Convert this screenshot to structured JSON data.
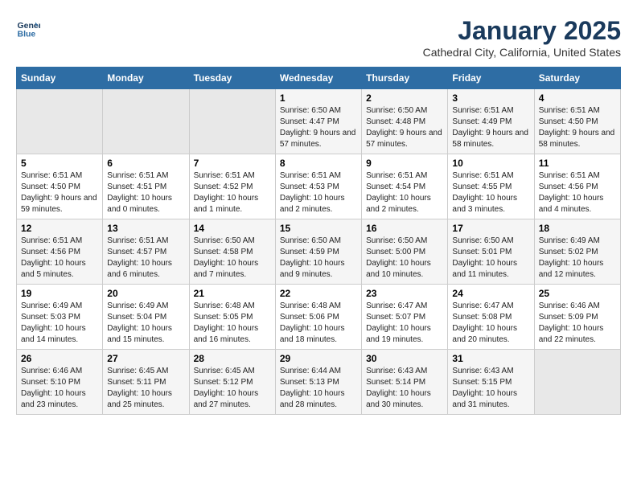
{
  "header": {
    "logo_line1": "General",
    "logo_line2": "Blue",
    "month": "January 2025",
    "location": "Cathedral City, California, United States"
  },
  "weekdays": [
    "Sunday",
    "Monday",
    "Tuesday",
    "Wednesday",
    "Thursday",
    "Friday",
    "Saturday"
  ],
  "weeks": [
    [
      {
        "day": "",
        "empty": true
      },
      {
        "day": "",
        "empty": true
      },
      {
        "day": "",
        "empty": true
      },
      {
        "day": "1",
        "sunrise": "6:50 AM",
        "sunset": "4:47 PM",
        "daylight": "9 hours and 57 minutes."
      },
      {
        "day": "2",
        "sunrise": "6:50 AM",
        "sunset": "4:48 PM",
        "daylight": "9 hours and 57 minutes."
      },
      {
        "day": "3",
        "sunrise": "6:51 AM",
        "sunset": "4:49 PM",
        "daylight": "9 hours and 58 minutes."
      },
      {
        "day": "4",
        "sunrise": "6:51 AM",
        "sunset": "4:50 PM",
        "daylight": "9 hours and 58 minutes."
      }
    ],
    [
      {
        "day": "5",
        "sunrise": "6:51 AM",
        "sunset": "4:50 PM",
        "daylight": "9 hours and 59 minutes."
      },
      {
        "day": "6",
        "sunrise": "6:51 AM",
        "sunset": "4:51 PM",
        "daylight": "10 hours and 0 minutes."
      },
      {
        "day": "7",
        "sunrise": "6:51 AM",
        "sunset": "4:52 PM",
        "daylight": "10 hours and 1 minute."
      },
      {
        "day": "8",
        "sunrise": "6:51 AM",
        "sunset": "4:53 PM",
        "daylight": "10 hours and 2 minutes."
      },
      {
        "day": "9",
        "sunrise": "6:51 AM",
        "sunset": "4:54 PM",
        "daylight": "10 hours and 2 minutes."
      },
      {
        "day": "10",
        "sunrise": "6:51 AM",
        "sunset": "4:55 PM",
        "daylight": "10 hours and 3 minutes."
      },
      {
        "day": "11",
        "sunrise": "6:51 AM",
        "sunset": "4:56 PM",
        "daylight": "10 hours and 4 minutes."
      }
    ],
    [
      {
        "day": "12",
        "sunrise": "6:51 AM",
        "sunset": "4:56 PM",
        "daylight": "10 hours and 5 minutes."
      },
      {
        "day": "13",
        "sunrise": "6:51 AM",
        "sunset": "4:57 PM",
        "daylight": "10 hours and 6 minutes."
      },
      {
        "day": "14",
        "sunrise": "6:50 AM",
        "sunset": "4:58 PM",
        "daylight": "10 hours and 7 minutes."
      },
      {
        "day": "15",
        "sunrise": "6:50 AM",
        "sunset": "4:59 PM",
        "daylight": "10 hours and 9 minutes."
      },
      {
        "day": "16",
        "sunrise": "6:50 AM",
        "sunset": "5:00 PM",
        "daylight": "10 hours and 10 minutes."
      },
      {
        "day": "17",
        "sunrise": "6:50 AM",
        "sunset": "5:01 PM",
        "daylight": "10 hours and 11 minutes."
      },
      {
        "day": "18",
        "sunrise": "6:49 AM",
        "sunset": "5:02 PM",
        "daylight": "10 hours and 12 minutes."
      }
    ],
    [
      {
        "day": "19",
        "sunrise": "6:49 AM",
        "sunset": "5:03 PM",
        "daylight": "10 hours and 14 minutes."
      },
      {
        "day": "20",
        "sunrise": "6:49 AM",
        "sunset": "5:04 PM",
        "daylight": "10 hours and 15 minutes."
      },
      {
        "day": "21",
        "sunrise": "6:48 AM",
        "sunset": "5:05 PM",
        "daylight": "10 hours and 16 minutes."
      },
      {
        "day": "22",
        "sunrise": "6:48 AM",
        "sunset": "5:06 PM",
        "daylight": "10 hours and 18 minutes."
      },
      {
        "day": "23",
        "sunrise": "6:47 AM",
        "sunset": "5:07 PM",
        "daylight": "10 hours and 19 minutes."
      },
      {
        "day": "24",
        "sunrise": "6:47 AM",
        "sunset": "5:08 PM",
        "daylight": "10 hours and 20 minutes."
      },
      {
        "day": "25",
        "sunrise": "6:46 AM",
        "sunset": "5:09 PM",
        "daylight": "10 hours and 22 minutes."
      }
    ],
    [
      {
        "day": "26",
        "sunrise": "6:46 AM",
        "sunset": "5:10 PM",
        "daylight": "10 hours and 23 minutes."
      },
      {
        "day": "27",
        "sunrise": "6:45 AM",
        "sunset": "5:11 PM",
        "daylight": "10 hours and 25 minutes."
      },
      {
        "day": "28",
        "sunrise": "6:45 AM",
        "sunset": "5:12 PM",
        "daylight": "10 hours and 27 minutes."
      },
      {
        "day": "29",
        "sunrise": "6:44 AM",
        "sunset": "5:13 PM",
        "daylight": "10 hours and 28 minutes."
      },
      {
        "day": "30",
        "sunrise": "6:43 AM",
        "sunset": "5:14 PM",
        "daylight": "10 hours and 30 minutes."
      },
      {
        "day": "31",
        "sunrise": "6:43 AM",
        "sunset": "5:15 PM",
        "daylight": "10 hours and 31 minutes."
      },
      {
        "day": "",
        "empty": true
      }
    ]
  ]
}
